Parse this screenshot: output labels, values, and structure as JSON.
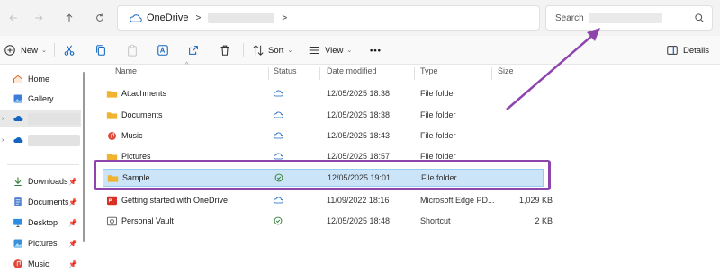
{
  "nav": {
    "back_icon": "arrow-left-icon",
    "forward_icon": "arrow-right-icon",
    "up_icon": "arrow-up-icon",
    "refresh_icon": "refresh-icon"
  },
  "address": {
    "root": "OneDrive",
    "separator": ">"
  },
  "search": {
    "placeholder": "Search"
  },
  "toolbar": {
    "new_label": "New",
    "sort_label": "Sort",
    "view_label": "View",
    "more_label": "•••",
    "details_label": "Details"
  },
  "sidebar": {
    "items": [
      {
        "label": "Home",
        "icon": "home-icon"
      },
      {
        "label": "Gallery",
        "icon": "gallery-icon"
      },
      {
        "label": "",
        "icon": "cloud-icon"
      },
      {
        "label": "",
        "icon": "cloud-icon"
      },
      {
        "label": "Downloads",
        "icon": "download-icon"
      },
      {
        "label": "Documents",
        "icon": "documents-icon"
      },
      {
        "label": "Desktop",
        "icon": "desktop-icon"
      },
      {
        "label": "Pictures",
        "icon": "pictures-icon"
      },
      {
        "label": "Music",
        "icon": "music-icon"
      }
    ]
  },
  "columns": {
    "name": "Name",
    "status": "Status",
    "date": "Date modified",
    "type": "Type",
    "size": "Size"
  },
  "files": [
    {
      "name": "Attachments",
      "status": "cloud",
      "date": "12/05/2025 18:38",
      "type": "File folder",
      "size": "",
      "icon": "folder-icon"
    },
    {
      "name": "Documents",
      "status": "cloud",
      "date": "12/05/2025 18:38",
      "type": "File folder",
      "size": "",
      "icon": "folder-icon"
    },
    {
      "name": "Music",
      "status": "cloud",
      "date": "12/05/2025 18:43",
      "type": "File folder",
      "size": "",
      "icon": "music-folder-icon"
    },
    {
      "name": "Pictures",
      "status": "cloud",
      "date": "12/05/2025 18:57",
      "type": "File folder",
      "size": "",
      "icon": "folder-icon"
    },
    {
      "name": "Sample",
      "status": "synced",
      "date": "12/05/2025 19:01",
      "type": "File folder",
      "size": "",
      "icon": "folder-icon"
    },
    {
      "name": "Getting started with OneDrive",
      "status": "cloud",
      "date": "11/09/2022 18:16",
      "type": "Microsoft Edge PD...",
      "size": "1,029 KB",
      "icon": "pdf-icon"
    },
    {
      "name": "Personal Vault",
      "status": "synced",
      "date": "12/05/2025 18:48",
      "type": "Shortcut",
      "size": "2 KB",
      "icon": "vault-icon"
    }
  ],
  "colors": {
    "highlight": "#8e44ad",
    "selected_row": "#cce4f7",
    "onedrive_blue": "#1565c0",
    "folder": "#f0b330",
    "sync_green": "#2e7d32"
  }
}
